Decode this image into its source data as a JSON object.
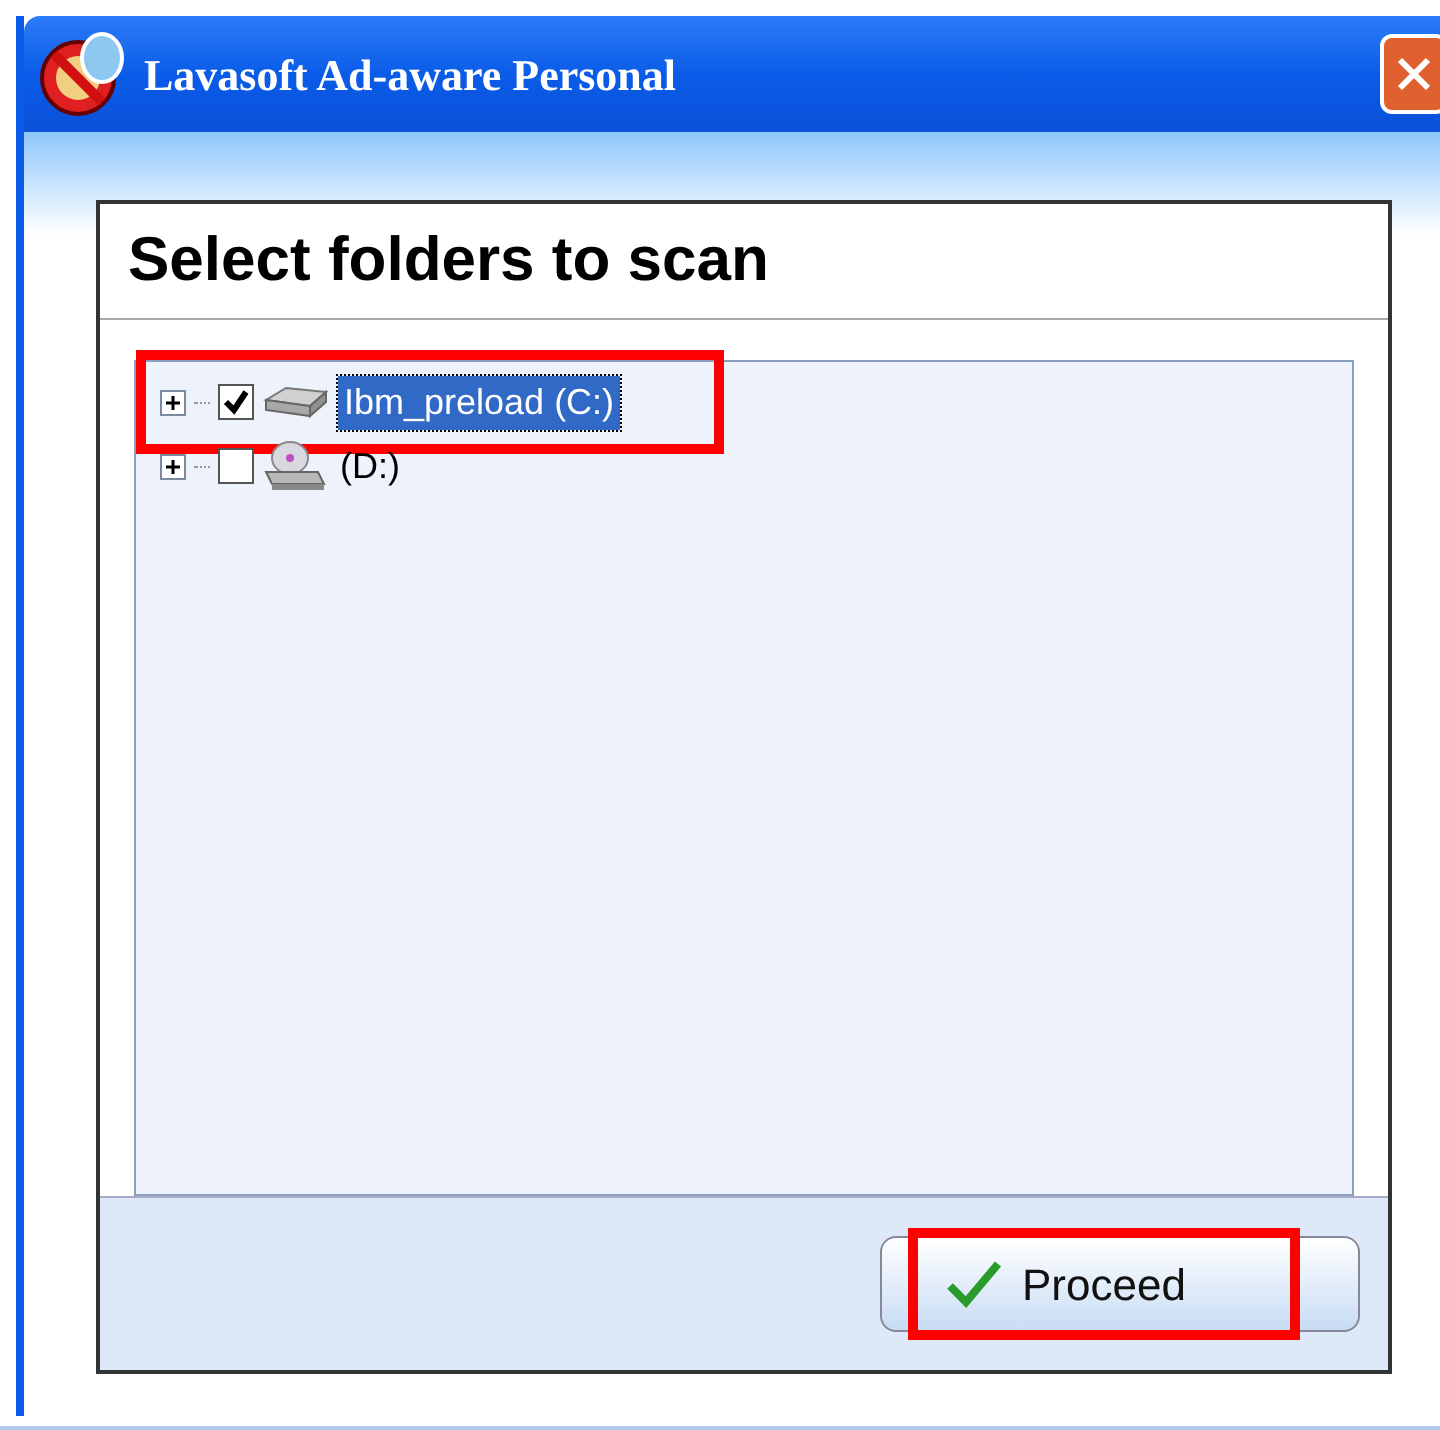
{
  "window": {
    "title": "Lavasoft Ad-aware Personal"
  },
  "heading": "Select folders to scan",
  "tree": {
    "items": [
      {
        "label": "Ibm_preload (C:)",
        "kind": "disk",
        "checked": true,
        "selected": true,
        "expanded": false,
        "highlighted": true
      },
      {
        "label": "(D:)",
        "kind": "cdrom",
        "checked": false,
        "selected": false,
        "expanded": false,
        "highlighted": false
      }
    ]
  },
  "proceed_button": {
    "label": "Proceed",
    "highlighted": true
  }
}
